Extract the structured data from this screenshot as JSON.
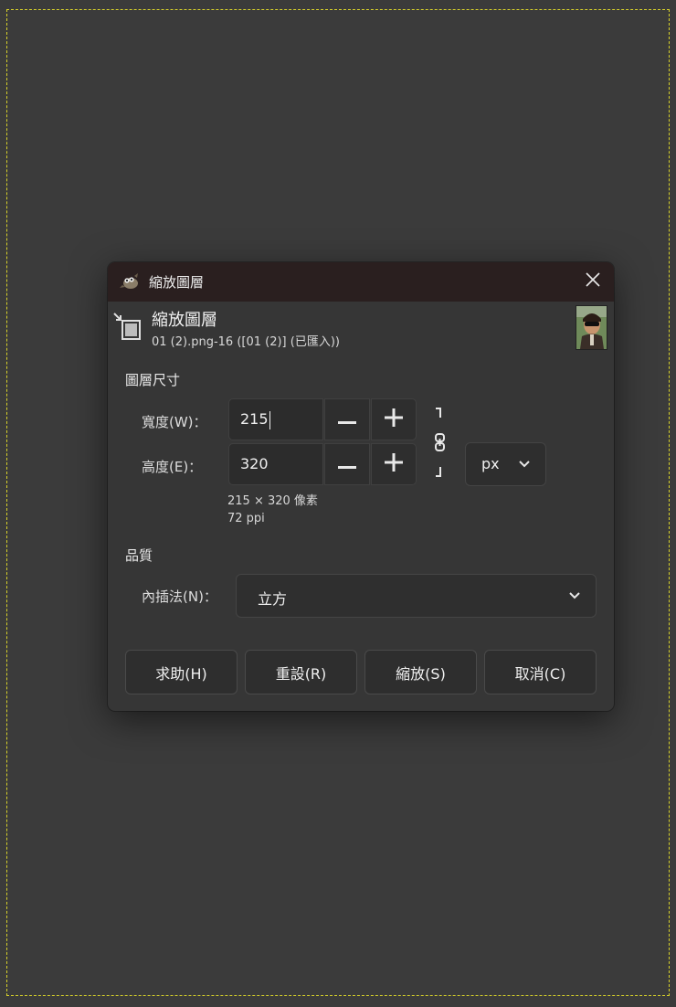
{
  "dialog": {
    "title": "縮放圖層",
    "header_title": "縮放圖層",
    "header_subtitle": "01 (2).png-16 ([01 (2)] (已匯入))",
    "app_icon": "gimp-wilber-icon",
    "close_icon": "close-icon",
    "header_icon": "scale-layer-icon"
  },
  "layer_size": {
    "section_label": "圖層尺寸",
    "width_label": "寬度(W)：",
    "width_value": "215",
    "height_label": "高度(E)：",
    "height_value": "320",
    "unit": "px",
    "pixel_info": "215 × 320 像素",
    "ppi_info": "72 ppi",
    "chain_icon": "chain-link-icon"
  },
  "quality": {
    "section_label": "品質",
    "interpolation_label": "內插法(N)：",
    "interpolation_value": "立方"
  },
  "buttons": {
    "help": "求助(H)",
    "reset": "重設(R)",
    "scale": "縮放(S)",
    "cancel": "取消(C)"
  },
  "colors": {
    "canvas": "#3b3b3b",
    "dialog_bg": "#363636",
    "titlebar_bg": "#2a1f1f",
    "layer_boundary": "#d8d22a"
  }
}
